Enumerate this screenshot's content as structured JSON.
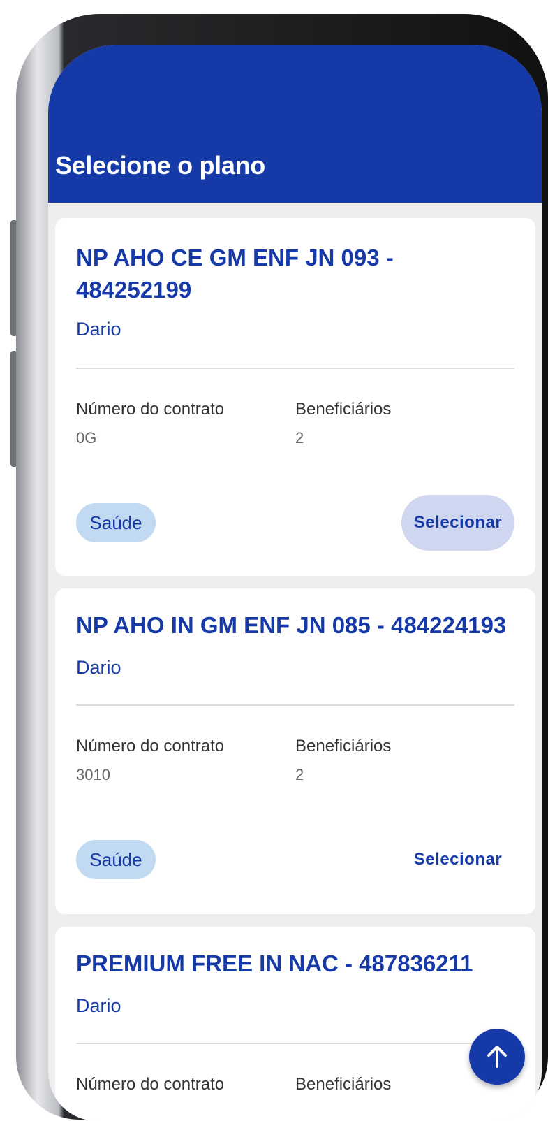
{
  "header": {
    "title": "Selecione o plano"
  },
  "plans": [
    {
      "title": "NP AHO CE GM ENF JN 093 - 484252199",
      "subtitle": "Dario",
      "contract_label": "Número do contrato",
      "contract_value": "0G",
      "beneficiaries_label": "Beneficiários",
      "beneficiaries_value": "2",
      "tag": "Saúde",
      "select_label": "Selecionar"
    },
    {
      "title": "NP AHO IN GM ENF JN 085 - 484224193",
      "subtitle": "Dario",
      "contract_label": "Número do contrato",
      "contract_value": "3010",
      "beneficiaries_label": "Beneficiários",
      "beneficiaries_value": "2",
      "tag": "Saúde",
      "select_label": "Selecionar"
    },
    {
      "title": "PREMIUM FREE IN NAC - 487836211",
      "subtitle": "Dario",
      "contract_label": "Número do contrato",
      "beneficiaries_label": "Beneficiários"
    }
  ],
  "fab": {
    "icon": "arrow-up-icon"
  },
  "colors": {
    "primary": "#1639a8",
    "chip": "#c2d9f2",
    "background": "#eeeeee"
  }
}
